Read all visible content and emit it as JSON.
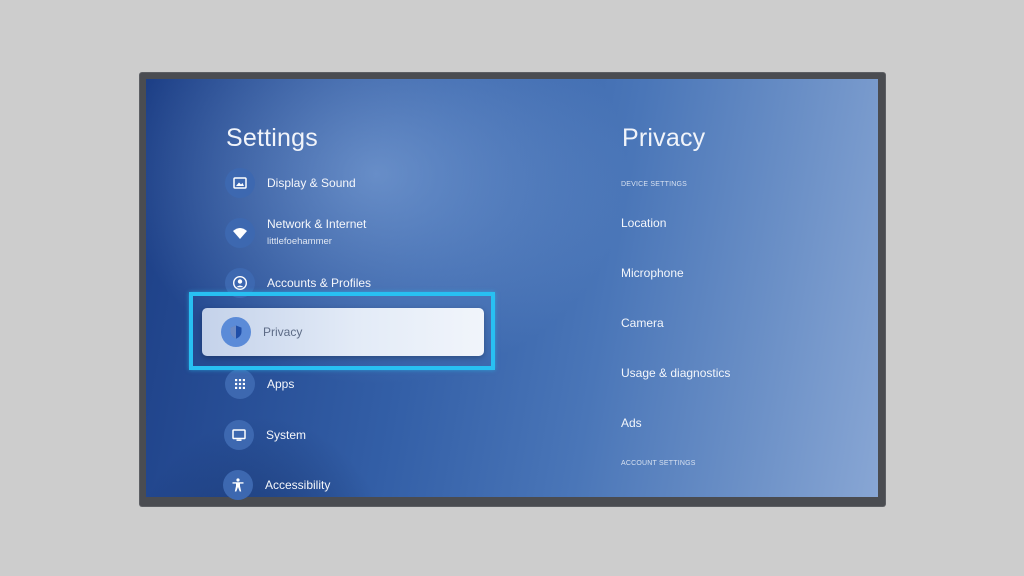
{
  "settings": {
    "title": "Settings",
    "items": [
      {
        "label": "Display & Sound",
        "icon": "image-icon"
      },
      {
        "label": "Network & Internet",
        "sub": "littlefoehammer",
        "icon": "wifi-icon"
      },
      {
        "label": "Accounts & Profiles",
        "icon": "account-icon"
      },
      {
        "label": "Privacy",
        "icon": "shield-icon",
        "focused": true
      },
      {
        "label": "Apps",
        "icon": "apps-grid-icon"
      },
      {
        "label": "System",
        "icon": "monitor-icon"
      },
      {
        "label": "Accessibility",
        "icon": "accessibility-icon"
      }
    ]
  },
  "privacy": {
    "title": "Privacy",
    "device_header": "DEVICE SETTINGS",
    "items": [
      "Location",
      "Microphone",
      "Camera",
      "Usage & diagnostics",
      "Ads"
    ],
    "account_header": "ACCOUNT SETTINGS"
  },
  "colors": {
    "focus_outline": "#28c0f2",
    "screen_blue": "#335fa7",
    "icon_circle": "#3d68b0"
  }
}
